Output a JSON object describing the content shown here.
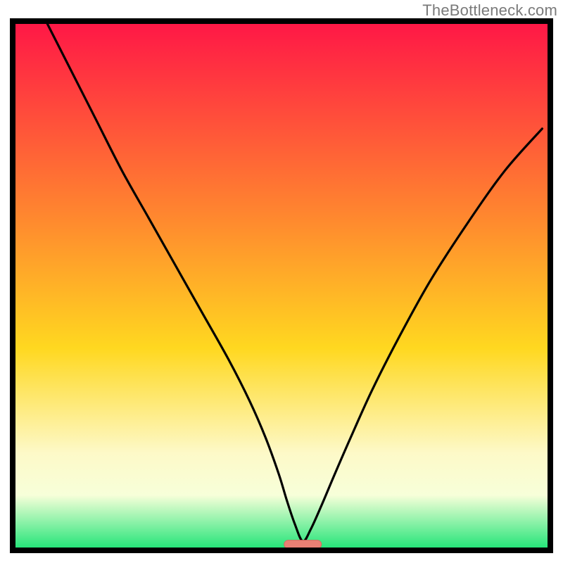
{
  "watermark": "TheBottleneck.com",
  "colors": {
    "frame": "#000000",
    "curve": "#000000",
    "marker_fill": "#e98074",
    "marker_stroke": "#d86a5f",
    "gradient_top": "#ff1846",
    "gradient_mid_upper": "#ff8b2e",
    "gradient_mid": "#ffd820",
    "gradient_pale_band_top": "#fdf9c8",
    "gradient_pale_band_bottom": "#f7ffd9",
    "gradient_bottom": "#27e57a"
  },
  "chart_data": {
    "type": "line",
    "title": "",
    "xlabel": "",
    "ylabel": "",
    "xlim": [
      0,
      100
    ],
    "ylim": [
      0,
      100
    ],
    "minimum_x": 54,
    "marker": {
      "x": 54,
      "y": 0.6,
      "width": 7,
      "height": 1.6,
      "rx": 0.8
    },
    "series": [
      {
        "name": "bottleneck-curve",
        "x": [
          6,
          10,
          15,
          20,
          25,
          30,
          35,
          40,
          44,
          47,
          49.5,
          51,
          52.5,
          54,
          55.5,
          57.5,
          60,
          63,
          67,
          72,
          78,
          85,
          92,
          99
        ],
        "values": [
          100,
          92,
          82,
          72,
          63,
          54,
          45,
          36,
          28,
          21,
          14,
          9,
          4.5,
          1.2,
          3.5,
          8,
          14,
          21,
          30,
          40,
          51,
          62,
          72,
          80
        ]
      }
    ],
    "background_gradient_stops": [
      {
        "offset": 0.0,
        "key": "gradient_top"
      },
      {
        "offset": 0.38,
        "key": "gradient_mid_upper"
      },
      {
        "offset": 0.62,
        "key": "gradient_mid"
      },
      {
        "offset": 0.82,
        "key": "gradient_pale_band_top"
      },
      {
        "offset": 0.9,
        "key": "gradient_pale_band_bottom"
      },
      {
        "offset": 1.0,
        "key": "gradient_bottom"
      }
    ]
  }
}
